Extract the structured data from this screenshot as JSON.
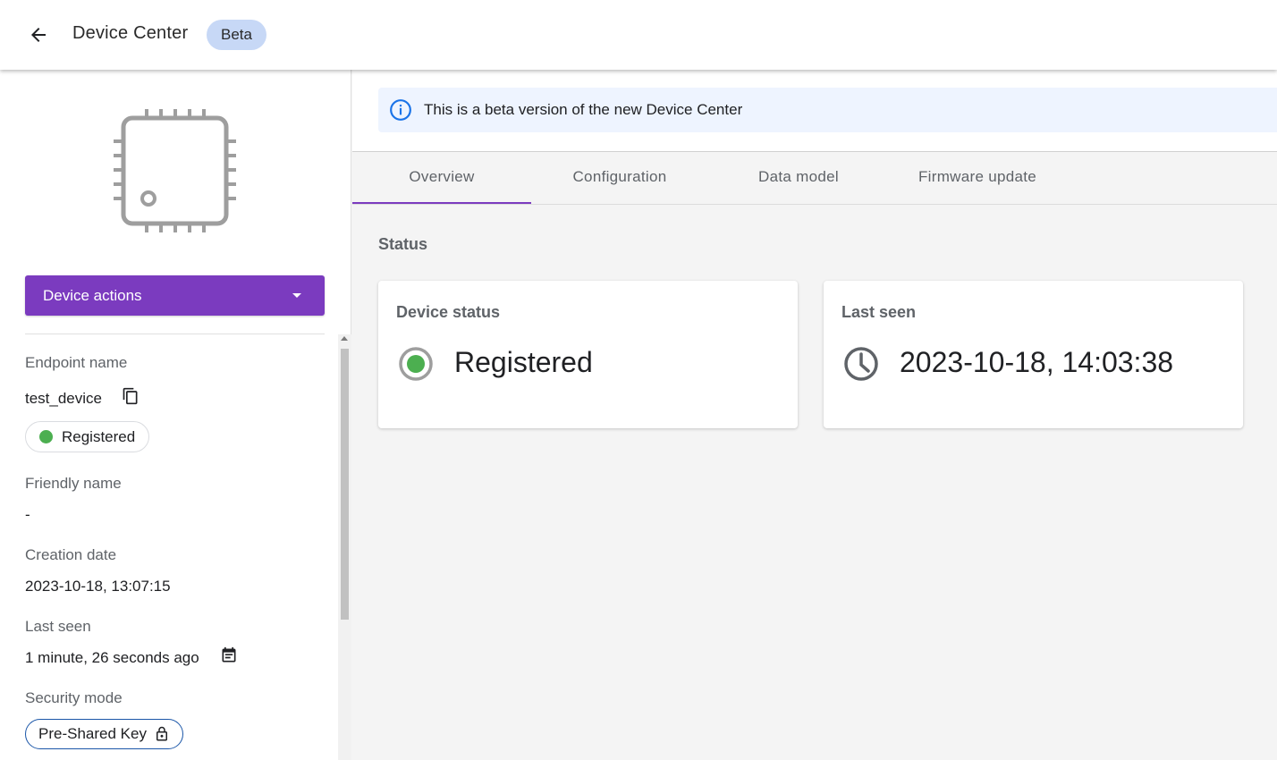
{
  "header": {
    "title": "Device Center",
    "badge": "Beta"
  },
  "sidebar": {
    "actions_button": "Device actions",
    "fields": {
      "endpoint_label": "Endpoint name",
      "endpoint_value": "test_device",
      "status_value": "Registered",
      "friendly_label": "Friendly name",
      "friendly_value": "-",
      "creation_label": "Creation date",
      "creation_value": "2023-10-18, 13:07:15",
      "last_seen_label": "Last seen",
      "last_seen_value": "1 minute, 26 seconds ago",
      "security_label": "Security mode",
      "security_value": "Pre-Shared Key"
    }
  },
  "main": {
    "banner_text": "This is a beta version of the new Device Center",
    "tabs": [
      {
        "label": "Overview"
      },
      {
        "label": "Configuration"
      },
      {
        "label": "Data model"
      },
      {
        "label": "Firmware update"
      }
    ],
    "active_tab": "Overview",
    "section_title": "Status",
    "cards": [
      {
        "title": "Device status",
        "value": "Registered"
      },
      {
        "title": "Last seen",
        "value": "2023-10-18, 14:03:38"
      }
    ]
  },
  "colors": {
    "accent": "#7b3bbf",
    "status_green": "#4caf50",
    "info_blue": "#1a73e8",
    "beta_chip": "#c7d8f6"
  },
  "icons": {
    "back": "arrow-back-icon",
    "device": "chip-icon",
    "dropdown": "caret-down-icon",
    "copy": "copy-icon",
    "calendar": "event-note-icon",
    "lock": "lock-icon",
    "info": "info-icon",
    "status": "radio-status-icon",
    "clock": "clock-icon"
  }
}
